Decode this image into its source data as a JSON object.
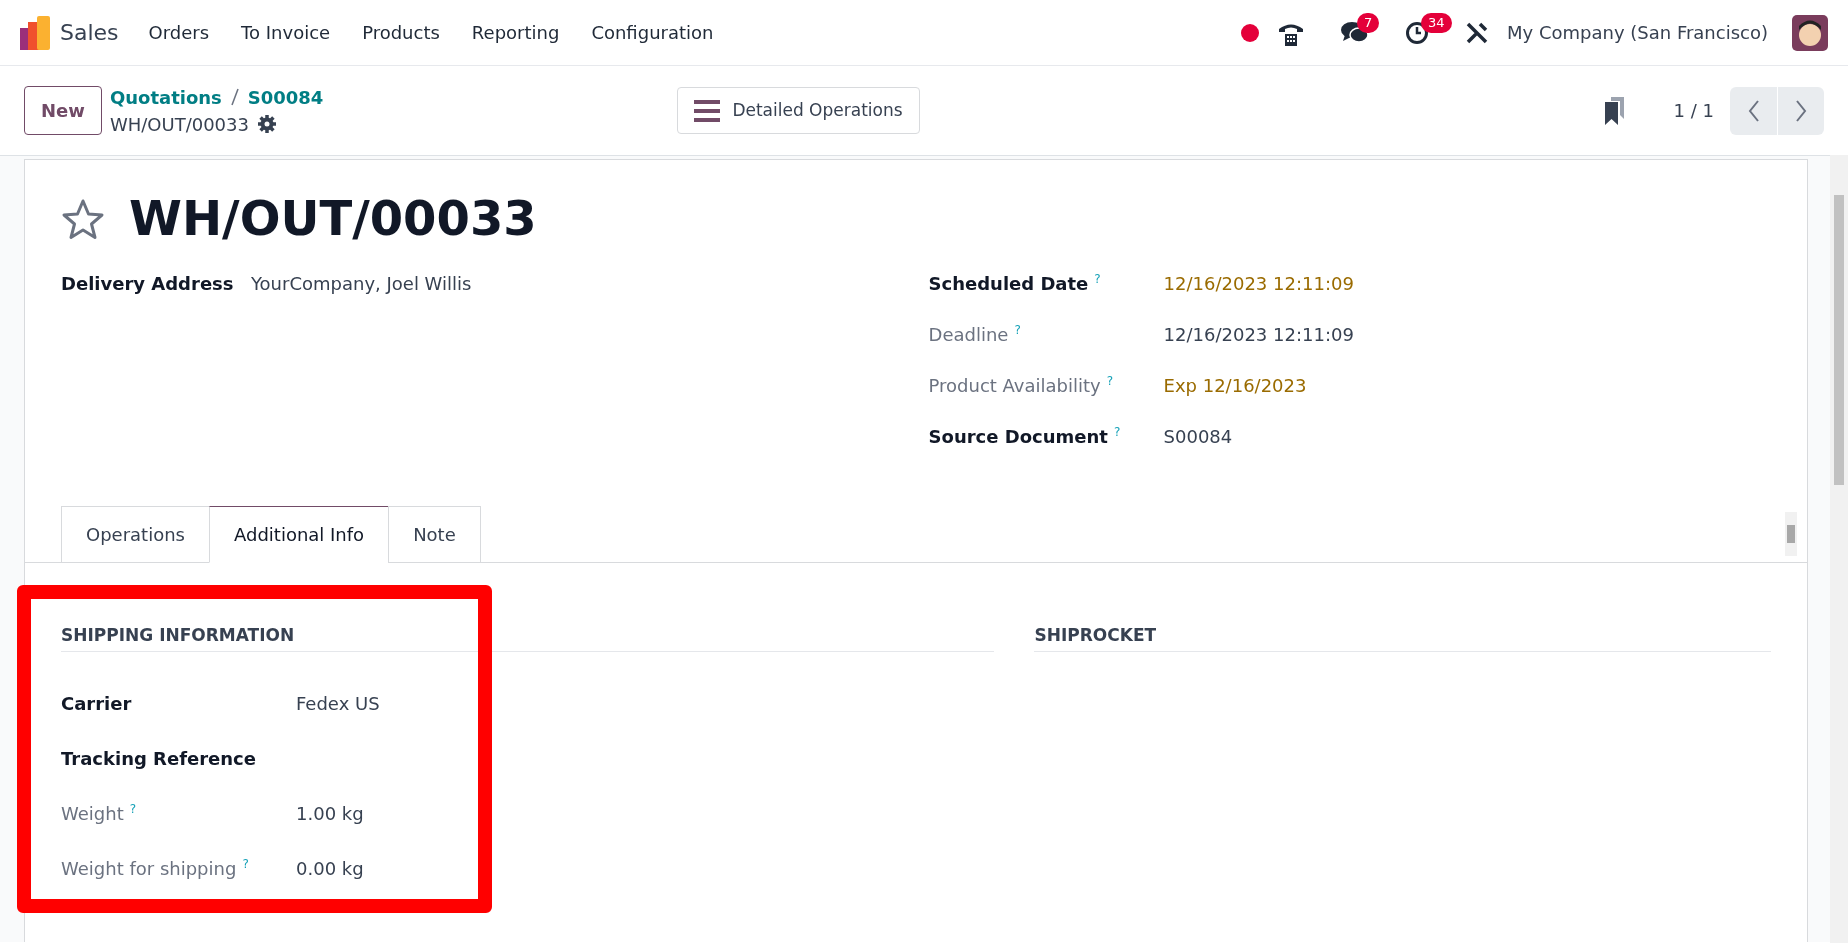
{
  "app": {
    "name": "Sales"
  },
  "menu": [
    "Orders",
    "To Invoice",
    "Products",
    "Reporting",
    "Configuration"
  ],
  "systray": {
    "messages_badge": "7",
    "activities_badge": "34",
    "company": "My Company (San Francisco)"
  },
  "control_panel": {
    "new_button": "New",
    "breadcrumbs": [
      "Quotations",
      "S00084"
    ],
    "record_name": "WH/OUT/00033",
    "action_button": "Detailed Operations",
    "pager": "1 / 1"
  },
  "record": {
    "title": "WH/OUT/00033",
    "starred": false,
    "left_fields": [
      {
        "label": "Delivery Address",
        "value": "YourCompany, Joel Willis",
        "emphasis": true,
        "warning": false
      }
    ],
    "right_fields": [
      {
        "label": "Scheduled Date",
        "help": "?",
        "value": "12/16/2023 12:11:09",
        "emphasis": true,
        "warning": true
      },
      {
        "label": "Deadline",
        "help": "?",
        "value": "12/16/2023 12:11:09",
        "emphasis": false,
        "warning": false
      },
      {
        "label": "Product Availability",
        "help": "?",
        "value": "Exp 12/16/2023",
        "emphasis": false,
        "warning": true
      },
      {
        "label": "Source Document",
        "help": "?",
        "value": "S00084",
        "emphasis": true,
        "warning": false
      }
    ],
    "tabs": [
      {
        "label": "Operations",
        "selected": false
      },
      {
        "label": "Additional Info",
        "selected": true
      },
      {
        "label": "Note",
        "selected": false
      }
    ],
    "sections": [
      {
        "title": "SHIPPING INFORMATION",
        "highlighted": true,
        "fields": [
          {
            "label": "Carrier",
            "value": "Fedex US",
            "emphasis": true,
            "warning": false
          },
          {
            "label": "Tracking Reference",
            "emphasis": true
          },
          {
            "label": "Weight",
            "help": "?",
            "value": "1.00 kg",
            "emphasis": false,
            "warning": false
          },
          {
            "label": "Weight for shipping",
            "help": "?",
            "value": "0.00 kg",
            "emphasis": false,
            "warning": false
          }
        ]
      },
      {
        "title": "SHIPROCKET",
        "highlighted": false
      }
    ]
  }
}
